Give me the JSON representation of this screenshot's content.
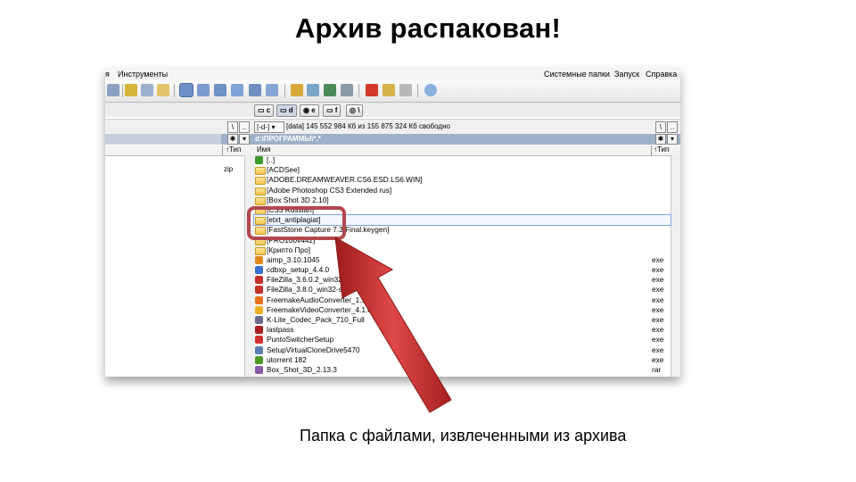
{
  "slide": {
    "title": "Архив распакован!",
    "caption": "Папка с файлами, извлеченными из архива"
  },
  "app": {
    "menu_left": [
      "я",
      "Инструменты"
    ],
    "menu_right": [
      "Системные папки",
      "Запуск",
      "Справка"
    ],
    "drives": [
      "c",
      "d",
      "e",
      "f",
      "\\"
    ],
    "drive_select": "[-d-]",
    "volume_info": "[data]  145 552 984 Кб из 155 875 324 Кб свободно",
    "path": "d:\\ПРОГРАММЫ\\*.*",
    "col_name": "Имя",
    "col_type": "↑Тип",
    "left_col_type": "↑Тип",
    "left_ext": "zip",
    "files": [
      {
        "name": "[..]",
        "ext": "",
        "icon": "up-arrow-icon",
        "color": "#3a9a2a"
      },
      {
        "name": "[ACDSee]",
        "ext": "",
        "icon": "folder-icon"
      },
      {
        "name": "[ADOBE.DREAMWEAVER.CS6.ESD.LS6.WIN]",
        "ext": "",
        "icon": "folder-icon"
      },
      {
        "name": "[Adobe Photoshop CS3 Extended rus]",
        "ext": "",
        "icon": "folder-icon"
      },
      {
        "name": "[Box Shot 3D 2.10]",
        "ext": "",
        "icon": "folder-icon"
      },
      {
        "name": "[CS5 Russian]",
        "ext": "",
        "icon": "folder-icon"
      },
      {
        "name": "[etxt_antiplagiat]",
        "ext": "",
        "icon": "folder-icon"
      },
      {
        "name": "[FastStone Capture 7.3.Final.keygen]",
        "ext": "",
        "icon": "folder-icon"
      },
      {
        "name": "[PRO100v442]",
        "ext": "",
        "icon": "folder-icon"
      },
      {
        "name": "[Крипто Про]",
        "ext": "",
        "icon": "folder-icon"
      },
      {
        "name": "aimp_3.10.1045",
        "ext": "exe",
        "icon": "aimp-icon",
        "color": "#e08a1e"
      },
      {
        "name": "cdbxp_setup_4.4.0",
        "ext": "exe",
        "icon": "disc-icon",
        "color": "#3b6fd1"
      },
      {
        "name": "FileZilla_3.6.0.2_win32-setup",
        "ext": "exe",
        "icon": "filezilla-icon",
        "color": "#c8302a"
      },
      {
        "name": "FileZilla_3.8.0_win32-setup",
        "ext": "exe",
        "icon": "filezilla-icon",
        "color": "#c8302a"
      },
      {
        "name": "FreemakeAudioConverter_1.1.0.53",
        "ext": "exe",
        "icon": "freemake-audio-icon",
        "color": "#e8731c"
      },
      {
        "name": "FreemakeVideoConverter_4.1.0",
        "ext": "exe",
        "icon": "freemake-video-icon",
        "color": "#f0b020"
      },
      {
        "name": "K-Lite_Codec_Pack_710_Full",
        "ext": "exe",
        "icon": "codec-icon",
        "color": "#6a6a8a"
      },
      {
        "name": "lastpass",
        "ext": "exe",
        "icon": "lastpass-icon",
        "color": "#b01f24"
      },
      {
        "name": "PuntoSwitcherSetup",
        "ext": "exe",
        "icon": "punto-icon",
        "color": "#d03030"
      },
      {
        "name": "SetupVirtualCloneDrive5470",
        "ext": "exe",
        "icon": "clonedrive-icon",
        "color": "#5a7fb0"
      },
      {
        "name": "utorrent 182",
        "ext": "exe",
        "icon": "utorrent-icon",
        "color": "#4a9a2a"
      },
      {
        "name": "Box_Shot_3D_2.13.3",
        "ext": "rar",
        "icon": "archive-icon",
        "color": "#8a5aa8"
      }
    ],
    "selected_index": 6
  },
  "colors": {
    "highlight_box": "#b3474f",
    "arrow": "#c62a2a",
    "path_bar": "#9fb0c9"
  }
}
